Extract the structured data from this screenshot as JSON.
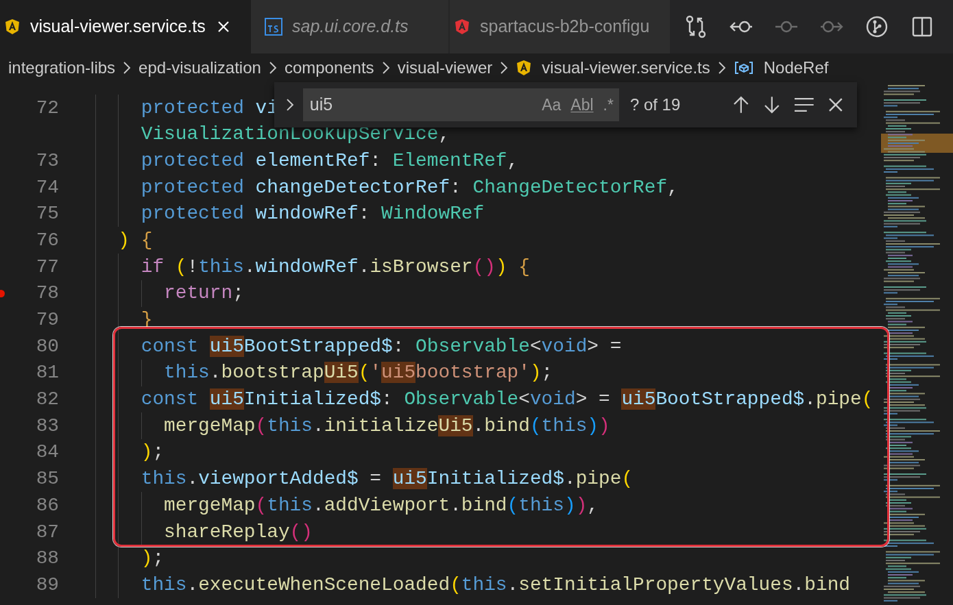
{
  "tabs": [
    {
      "label": "visual-viewer.service.ts",
      "kind": "angular",
      "selected": true,
      "preview": false
    },
    {
      "label": "sap.ui.core.d.ts",
      "kind": "ts",
      "selected": false,
      "preview": true
    },
    {
      "label": "spartacus-b2b-configu",
      "kind": "angular-red",
      "selected": false,
      "preview": false
    }
  ],
  "breadcrumbs": [
    {
      "label": "integration-libs",
      "kind": "folder"
    },
    {
      "label": "epd-visualization",
      "kind": "folder"
    },
    {
      "label": "components",
      "kind": "folder"
    },
    {
      "label": "visual-viewer",
      "kind": "folder"
    },
    {
      "label": "visual-viewer.service.ts",
      "kind": "angular"
    },
    {
      "label": "NodeRef",
      "kind": "symbol"
    }
  ],
  "find": {
    "value": "ui5",
    "options": [
      "Aa",
      "Abl",
      ".*"
    ],
    "count": "? of 19"
  },
  "lines": [
    {
      "number": "72",
      "breakpoint": false,
      "kind": "i2",
      "tokens": [
        {
          "text": "protected ",
          "kind": "kw"
        },
        {
          "text": "vi",
          "kind": "var"
        }
      ]
    },
    {
      "breakpoint": false,
      "kind": "i2",
      "tokens": [
        {
          "text": "VisualizationLookupService",
          "kind": "type"
        },
        {
          "text": ",",
          "kind": "punc"
        }
      ]
    },
    {
      "number": "73",
      "breakpoint": false,
      "kind": "i2",
      "tokens": [
        {
          "text": "protected ",
          "kind": "kw"
        },
        {
          "text": "elementRef",
          "kind": "var"
        },
        {
          "text": ": ",
          "kind": "punc"
        },
        {
          "text": "ElementRef",
          "kind": "type"
        },
        {
          "text": ",",
          "kind": "punc"
        }
      ]
    },
    {
      "number": "74",
      "breakpoint": false,
      "kind": "i2",
      "tokens": [
        {
          "text": "protected ",
          "kind": "kw"
        },
        {
          "text": "changeDetectorRef",
          "kind": "var"
        },
        {
          "text": ": ",
          "kind": "punc"
        },
        {
          "text": "ChangeDetectorRef",
          "kind": "type"
        },
        {
          "text": ",",
          "kind": "punc"
        }
      ]
    },
    {
      "number": "75",
      "breakpoint": false,
      "kind": "i2",
      "tokens": [
        {
          "text": "protected ",
          "kind": "kw"
        },
        {
          "text": "windowRef",
          "kind": "var"
        },
        {
          "text": ": ",
          "kind": "punc"
        },
        {
          "text": "WindowRef",
          "kind": "type"
        }
      ]
    },
    {
      "number": "76",
      "breakpoint": false,
      "kind": "i1",
      "tokens": [
        {
          "text": ")",
          "kind": "b1"
        },
        {
          "text": " {",
          "kind": "brace"
        }
      ]
    },
    {
      "number": "77",
      "breakpoint": false,
      "kind": "i2",
      "tokens": [
        {
          "text": "if ",
          "kind": "ctrl"
        },
        {
          "text": "(",
          "kind": "b1"
        },
        {
          "text": "!",
          "kind": "punc"
        },
        {
          "text": "this",
          "kind": "kw"
        },
        {
          "text": ".",
          "kind": "punc"
        },
        {
          "text": "windowRef",
          "kind": "var"
        },
        {
          "text": ".",
          "kind": "punc"
        },
        {
          "text": "isBrowser",
          "kind": "fn"
        },
        {
          "text": "()",
          "kind": "b2"
        },
        {
          "text": ")",
          "kind": "b1"
        },
        {
          "text": " {",
          "kind": "brace"
        }
      ]
    },
    {
      "number": "78",
      "breakpoint": true,
      "kind": "i3",
      "tokens": [
        {
          "text": "return",
          "kind": "ctrl"
        },
        {
          "text": ";",
          "kind": "punc"
        }
      ]
    },
    {
      "number": "79",
      "breakpoint": false,
      "kind": "i2",
      "tokens": [
        {
          "text": "}",
          "kind": "brace"
        }
      ]
    },
    {
      "number": "80",
      "breakpoint": false,
      "kind": "i2",
      "tokens": [
        {
          "text": "const ",
          "kind": "kw"
        },
        {
          "text": "ui5",
          "kind": "match-var"
        },
        {
          "text": "BootStrapped$",
          "kind": "var"
        },
        {
          "text": ": ",
          "kind": "punc"
        },
        {
          "text": "Observable",
          "kind": "type"
        },
        {
          "text": "<",
          "kind": "punc"
        },
        {
          "text": "void",
          "kind": "kw"
        },
        {
          "text": "> =",
          "kind": "punc"
        }
      ]
    },
    {
      "number": "81",
      "breakpoint": false,
      "kind": "i3",
      "tokens": [
        {
          "text": "this",
          "kind": "kw"
        },
        {
          "text": ".",
          "kind": "punc"
        },
        {
          "text": "bootstrap",
          "kind": "fn"
        },
        {
          "text": "Ui5",
          "kind": "match-fn"
        },
        {
          "text": "(",
          "kind": "b1"
        },
        {
          "text": "'",
          "kind": "str"
        },
        {
          "text": "ui5",
          "kind": "match-str"
        },
        {
          "text": "bootstrap'",
          "kind": "str"
        },
        {
          "text": ")",
          "kind": "b1"
        },
        {
          "text": ";",
          "kind": "punc"
        }
      ]
    },
    {
      "number": "82",
      "breakpoint": false,
      "kind": "i2",
      "tokens": [
        {
          "text": "const ",
          "kind": "kw"
        },
        {
          "text": "ui5",
          "kind": "match-var"
        },
        {
          "text": "Initialized$",
          "kind": "var"
        },
        {
          "text": ": ",
          "kind": "punc"
        },
        {
          "text": "Observable",
          "kind": "type"
        },
        {
          "text": "<",
          "kind": "punc"
        },
        {
          "text": "void",
          "kind": "kw"
        },
        {
          "text": "> = ",
          "kind": "punc"
        },
        {
          "text": "ui5",
          "kind": "match-var"
        },
        {
          "text": "BootStrapped$",
          "kind": "var"
        },
        {
          "text": ".",
          "kind": "punc"
        },
        {
          "text": "pipe",
          "kind": "fn"
        },
        {
          "text": "(",
          "kind": "b1"
        }
      ]
    },
    {
      "number": "83",
      "breakpoint": false,
      "kind": "i3",
      "tokens": [
        {
          "text": "mergeMap",
          "kind": "fn"
        },
        {
          "text": "(",
          "kind": "b2"
        },
        {
          "text": "this",
          "kind": "kw"
        },
        {
          "text": ".",
          "kind": "punc"
        },
        {
          "text": "initialize",
          "kind": "fn"
        },
        {
          "text": "Ui5",
          "kind": "match-fn"
        },
        {
          "text": ".",
          "kind": "punc"
        },
        {
          "text": "bind",
          "kind": "fn"
        },
        {
          "text": "(",
          "kind": "b3"
        },
        {
          "text": "this",
          "kind": "kw"
        },
        {
          "text": ")",
          "kind": "b3"
        },
        {
          "text": ")",
          "kind": "b2"
        }
      ]
    },
    {
      "number": "84",
      "breakpoint": false,
      "kind": "i2",
      "tokens": [
        {
          "text": ")",
          "kind": "b1"
        },
        {
          "text": ";",
          "kind": "punc"
        }
      ]
    },
    {
      "number": "85",
      "breakpoint": false,
      "kind": "i2",
      "tokens": [
        {
          "text": "this",
          "kind": "kw"
        },
        {
          "text": ".",
          "kind": "punc"
        },
        {
          "text": "viewportAdded$",
          "kind": "var"
        },
        {
          "text": " = ",
          "kind": "punc"
        },
        {
          "text": "ui5",
          "kind": "match-var"
        },
        {
          "text": "Initialized$",
          "kind": "var"
        },
        {
          "text": ".",
          "kind": "punc"
        },
        {
          "text": "pipe",
          "kind": "fn"
        },
        {
          "text": "(",
          "kind": "b1"
        }
      ]
    },
    {
      "number": "86",
      "breakpoint": false,
      "kind": "i3",
      "tokens": [
        {
          "text": "mergeMap",
          "kind": "fn"
        },
        {
          "text": "(",
          "kind": "b2"
        },
        {
          "text": "this",
          "kind": "kw"
        },
        {
          "text": ".",
          "kind": "punc"
        },
        {
          "text": "addViewport",
          "kind": "fn"
        },
        {
          "text": ".",
          "kind": "punc"
        },
        {
          "text": "bind",
          "kind": "fn"
        },
        {
          "text": "(",
          "kind": "b3"
        },
        {
          "text": "this",
          "kind": "kw"
        },
        {
          "text": ")",
          "kind": "b3"
        },
        {
          "text": ")",
          "kind": "b2"
        },
        {
          "text": ",",
          "kind": "punc"
        }
      ]
    },
    {
      "number": "87",
      "breakpoint": false,
      "kind": "i3",
      "tokens": [
        {
          "text": "shareReplay",
          "kind": "fn"
        },
        {
          "text": "()",
          "kind": "b2"
        }
      ]
    },
    {
      "number": "88",
      "breakpoint": false,
      "kind": "i2",
      "tokens": [
        {
          "text": ")",
          "kind": "b1"
        },
        {
          "text": ";",
          "kind": "punc"
        }
      ]
    },
    {
      "number": "89",
      "breakpoint": false,
      "kind": "i2",
      "tokens": [
        {
          "text": "this",
          "kind": "kw"
        },
        {
          "text": ".",
          "kind": "punc"
        },
        {
          "text": "executeWhenSceneLoaded",
          "kind": "fn"
        },
        {
          "text": "(",
          "kind": "b1"
        },
        {
          "text": "this",
          "kind": "kw"
        },
        {
          "text": ".",
          "kind": "punc"
        },
        {
          "text": "setInitialPropertyValues",
          "kind": "fn"
        },
        {
          "text": ".",
          "kind": "punc"
        },
        {
          "text": "bind",
          "kind": "fn"
        }
      ]
    }
  ]
}
